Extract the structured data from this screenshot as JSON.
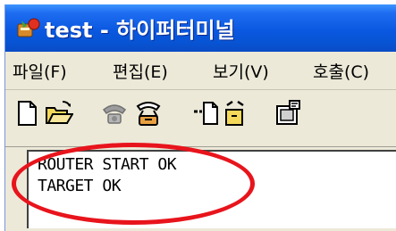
{
  "window": {
    "title": "test - 하이퍼터미널"
  },
  "menu": {
    "items": [
      {
        "label": "파일(F)"
      },
      {
        "label": "편집(E)"
      },
      {
        "label": "보기(V)"
      },
      {
        "label": "호출(C)"
      }
    ]
  },
  "toolbar": {
    "buttons": [
      {
        "icon": "new-document-icon"
      },
      {
        "icon": "open-folder-icon"
      },
      {
        "icon": "phone-call-icon"
      },
      {
        "icon": "phone-disconnect-icon"
      },
      {
        "icon": "send-file-icon"
      },
      {
        "icon": "receive-file-icon"
      },
      {
        "icon": "properties-icon"
      }
    ]
  },
  "terminal": {
    "lines": [
      "ROUTER START OK",
      "TARGET OK"
    ]
  },
  "colors": {
    "titlebar": "#0a58e0",
    "highlight": "#e8141c",
    "chrome": "#ece9d8"
  }
}
